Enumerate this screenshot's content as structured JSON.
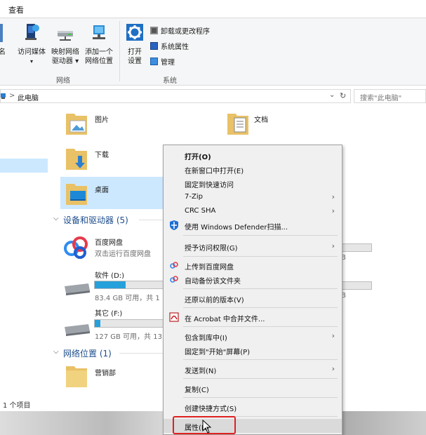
{
  "ribbon": {
    "tab_view": "查看",
    "cut_label": "名",
    "media_label": "访问媒体",
    "map_drive_l1": "映射网络",
    "map_drive_l2": "驱动器 ▾",
    "add_loc_l1": "添加一个",
    "add_loc_l2": "网络位置",
    "open_l1": "打开",
    "open_l2": "设置",
    "uninstall": "卸载或更改程序",
    "sys_props": "系统属性",
    "manage": "管理",
    "group_network": "网络",
    "group_system": "系统"
  },
  "address": {
    "path_sep": ">",
    "path": "此电脑",
    "search_placeholder": "搜索\"此电脑\""
  },
  "folders": [
    {
      "label": "图片"
    },
    {
      "label": "文档"
    },
    {
      "label": "下载"
    },
    {
      "label": "桌面"
    }
  ],
  "devices": {
    "title": "设备和驱动器 (5)",
    "baidu_name": "百度网盘",
    "baidu_sub": "双击运行百度网盘",
    "drive_d_name": "软件 (D:)",
    "drive_d_sub": "83.4 GB 可用，共 1",
    "drive_d_used": 0.45,
    "drive_f_name": "其它 (F:)",
    "drive_f_sub": "127 GB 可用，共 13",
    "drive_f_used": 0.08,
    "right_b1": "B",
    "right_b2": "B"
  },
  "network": {
    "title": "网络位置 (1)",
    "item": "营销部"
  },
  "status": {
    "count": "1 个项目"
  },
  "context_menu": {
    "open": "打开(O)",
    "open_new": "在新窗口中打开(E)",
    "pin_quick": "固定到快速访问",
    "zip": "7-Zip",
    "crc": "CRC SHA",
    "defender": "使用 Windows Defender扫描...",
    "grant": "授予访问权限(G)",
    "upload_baidu": "上传到百度网盘",
    "auto_backup": "自动备份该文件夹",
    "restore": "还原以前的版本(V)",
    "acrobat": "在 Acrobat 中合并文件...",
    "include_lib": "包含到库中(I)",
    "pin_start": "固定到\"开始\"屏幕(P)",
    "send_to": "发送到(N)",
    "copy": "复制(C)",
    "shortcut": "创建快捷方式(S)",
    "properties": "属性(R)",
    "arrow": "›"
  },
  "colors": {
    "accent": "#26a0da",
    "highlight": "#e02020",
    "selection": "#cce8ff"
  }
}
